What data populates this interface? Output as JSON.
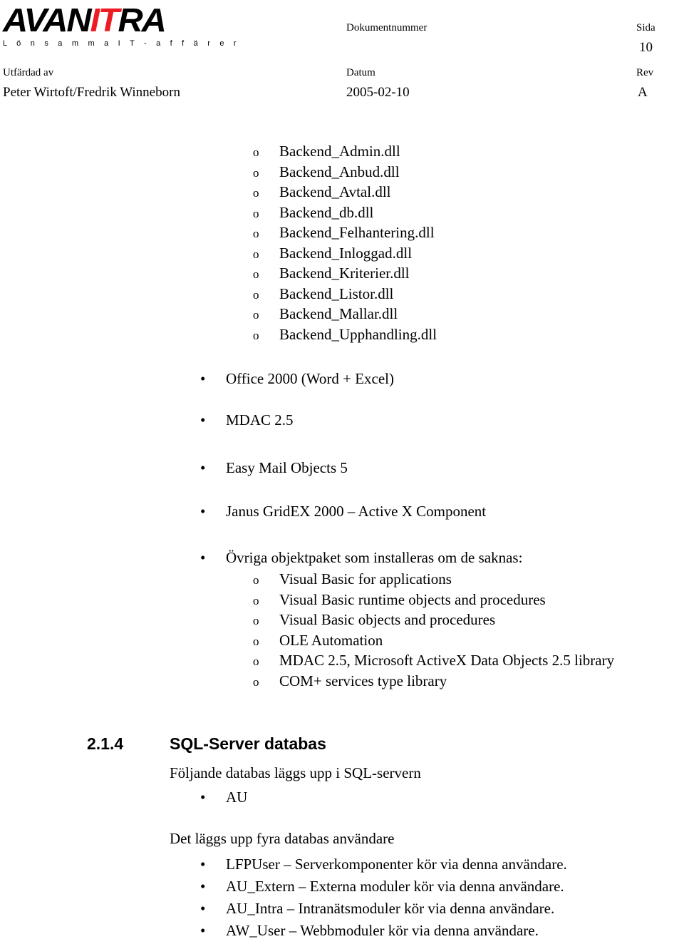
{
  "header": {
    "logo": {
      "word_part1": "AVAN",
      "word_accent": "IT",
      "word_part2": "RA",
      "tagline": "L ö n s a m m a   I T - a f f ä r e r",
      "accent_color": "#ED1C24"
    },
    "fields": {
      "dokumentnummer_label": "Dokumentnummer",
      "dokumentnummer_value": "",
      "sida_label": "Sida",
      "sida_value": "10",
      "utfardad_av_label": "Utfärdad av",
      "utfardad_av_value": "Peter Wirtoft/Fredrik Winneborn",
      "datum_label": "Datum",
      "datum_value": "2005-02-10",
      "rev_label": "Rev",
      "rev_value": "A"
    }
  },
  "body": {
    "backend_dlls": [
      "Backend_Admin.dll",
      "Backend_Anbud.dll",
      "Backend_Avtal.dll",
      "Backend_db.dll",
      "Backend_Felhantering.dll",
      "Backend_Inloggad.dll",
      "Backend_Kriterier.dll",
      "Backend_Listor.dll",
      "Backend_Mallar.dll",
      "Backend_Upphandling.dll"
    ],
    "components": [
      "Office 2000 (Word + Excel)",
      "MDAC 2.5",
      "Easy Mail Objects 5",
      "Janus GridEX 2000 – Active X Component"
    ],
    "ovriga_heading": "Övriga objektpaket som installeras om de saknas:",
    "ovriga_items": [
      "Visual Basic for applications",
      "Visual Basic runtime objects and procedures",
      "Visual Basic objects and procedures",
      "OLE Automation",
      "MDAC 2.5, Microsoft ActiveX Data Objects 2.5 library",
      "COM+ services type library"
    ],
    "section": {
      "number": "2.1.4",
      "title": "SQL-Server databas",
      "intro": "Följande databas läggs upp i SQL-servern",
      "databases": [
        "AU"
      ],
      "users_intro": "Det läggs upp fyra databas användare",
      "users": [
        "LFPUser – Serverkomponenter kör via denna användare.",
        "AU_Extern – Externa moduler kör via denna användare.",
        "AU_Intra – Intranätsmoduler kör via denna användare.",
        "AW_User – Webbmoduler kör via denna användare."
      ]
    }
  },
  "markers": {
    "hollow": "o",
    "filled": "•"
  }
}
